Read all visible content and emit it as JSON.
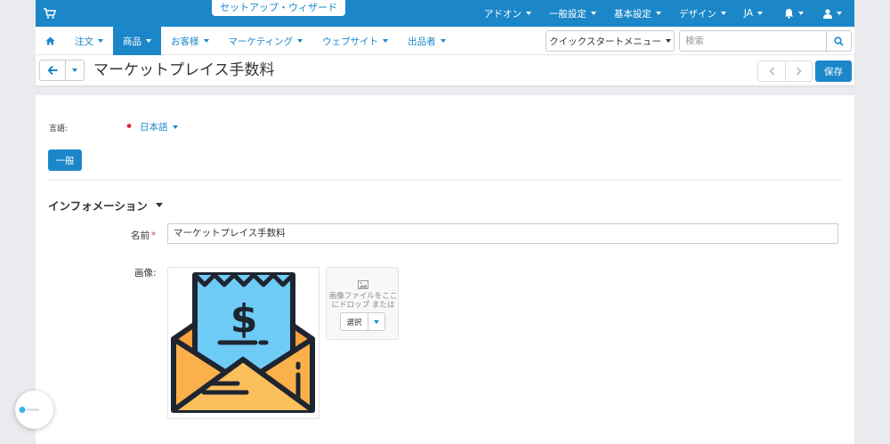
{
  "topbar": {
    "setup_wizard": "セットアップ・ウィザード",
    "menu": [
      "アドオン",
      "一般設定",
      "基本設定",
      "デザイン",
      "JA"
    ]
  },
  "nav": {
    "items": [
      {
        "label": "注文",
        "active": false
      },
      {
        "label": "商品",
        "active": true
      },
      {
        "label": "お客様",
        "active": false
      },
      {
        "label": "マーケティング",
        "active": false
      },
      {
        "label": "ウェブサイト",
        "active": false
      },
      {
        "label": "出品者",
        "active": false
      }
    ],
    "quickstart": "クイックスタートメニュー",
    "search_placeholder": "検索"
  },
  "titlebar": {
    "title": "マーケットプレイス手数料",
    "save": "保存"
  },
  "form": {
    "language_label": "言語:",
    "language_value": "日本語",
    "tab_general": "一般",
    "section_title": "インフォメーション",
    "name_label": "名前",
    "name_required": "*",
    "name_value": "マーケットプレイス手数料",
    "image_label": "画像:",
    "drop_text": "画像ファイルをここにドロップ または",
    "select_label": "選択"
  },
  "colors": {
    "accent": "#1b87c9",
    "envelope": "#fbb14b",
    "receipt": "#6ecbf5"
  }
}
